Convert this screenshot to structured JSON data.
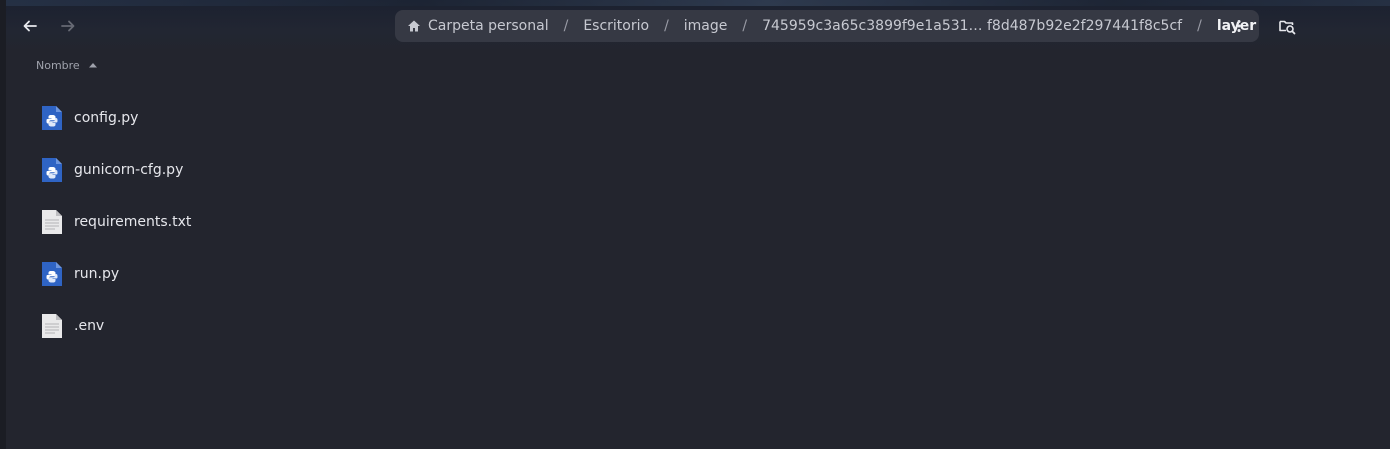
{
  "header": {
    "back_icon": "arrow-left-icon",
    "forward_icon": "arrow-right-icon",
    "breadcrumbs": [
      {
        "label": "Carpeta personal",
        "icon": "home-icon"
      },
      {
        "label": "Escritorio"
      },
      {
        "label": "image"
      },
      {
        "label": "745959c3a65c3899f9e1a531… f8d487b92e2f297441f8c5cf"
      },
      {
        "label": "layer"
      }
    ],
    "separator": "/",
    "menu_icon": "kebab-menu-icon",
    "search_icon": "folder-search-icon"
  },
  "list": {
    "column_header": "Nombre",
    "sort": "ascending",
    "files": [
      {
        "name": "config.py",
        "icon": "python-file-icon"
      },
      {
        "name": "gunicorn-cfg.py",
        "icon": "python-file-icon"
      },
      {
        "name": "requirements.txt",
        "icon": "text-file-icon"
      },
      {
        "name": "run.py",
        "icon": "python-file-icon"
      },
      {
        "name": ".env",
        "icon": "text-file-icon"
      }
    ]
  },
  "colors": {
    "background": "#23252e",
    "breadcrumb_bg": "#363944",
    "python_icon": "#2f64c4",
    "text": "#e6e7ec"
  }
}
